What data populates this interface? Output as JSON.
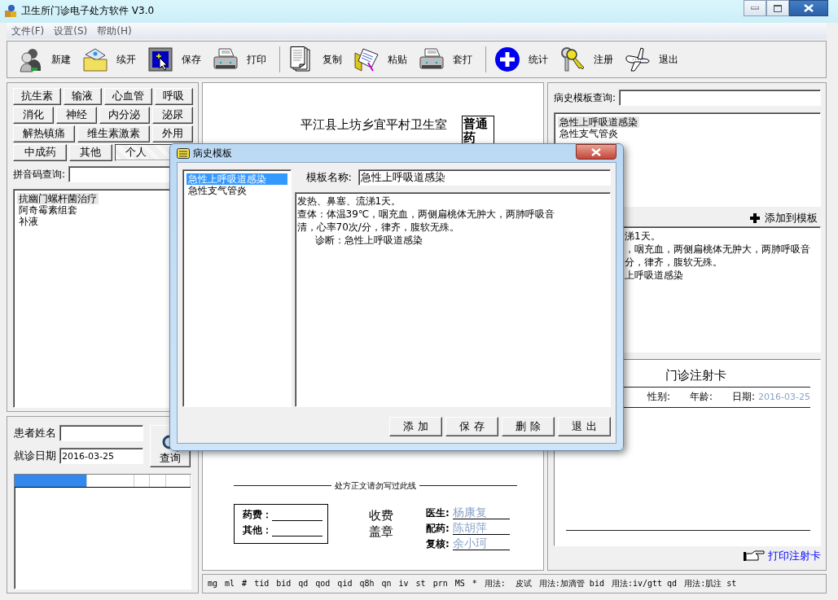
{
  "window": {
    "title": "卫生所门诊电子处方软件 V3.0"
  },
  "menu": [
    "文件(F)",
    "设置(S)",
    "帮助(H)"
  ],
  "toolbar": {
    "groups": [
      {
        "items": [
          {
            "label": "新建"
          },
          {
            "label": "续开"
          },
          {
            "label": "保存"
          },
          {
            "label": "打印"
          }
        ]
      },
      {
        "items": [
          {
            "label": "复制"
          },
          {
            "label": "粘贴"
          },
          {
            "label": "套打"
          }
        ]
      },
      {
        "items": [
          {
            "label": "统计"
          },
          {
            "label": "注册"
          },
          {
            "label": "退出"
          }
        ]
      }
    ]
  },
  "categories": [
    {
      "buttons": [
        {
          "label": "抗生素",
          "selected": false
        },
        {
          "label": "输液",
          "selected": false
        },
        {
          "label": "心血管",
          "selected": false
        },
        {
          "label": "呼吸",
          "selected": false
        }
      ]
    },
    {
      "buttons": [
        {
          "label": "消化",
          "selected": false
        },
        {
          "label": "神经",
          "selected": false
        },
        {
          "label": "内分泌",
          "selected": false
        },
        {
          "label": "泌尿",
          "selected": false
        }
      ]
    },
    {
      "buttons": [
        {
          "label": "解热镇痛",
          "selected": false
        },
        {
          "label": "维生素激素",
          "selected": false
        },
        {
          "label": "外用",
          "selected": false
        }
      ]
    },
    {
      "buttons": [
        {
          "label": "中成药",
          "selected": false
        },
        {
          "label": "其他",
          "selected": false
        },
        {
          "label": "个人",
          "selected": true
        }
      ]
    }
  ],
  "pinyin_search": {
    "label": "拼音码查询:"
  },
  "drug_groups": [
    {
      "label": "抗幽门螺杆菌治疗",
      "selected": true
    },
    {
      "label": "阿奇霉素组套",
      "selected": false
    },
    {
      "label": "补液",
      "selected": false
    }
  ],
  "patient": {
    "name_label": "患者姓名",
    "date_label": "就诊日期",
    "date_value": "2016-03-25",
    "query_button": "查询"
  },
  "prescription": {
    "clinic": "平江县上坊乡宜平村卫生室",
    "category_box": "普通药",
    "divider_note": "处方正文请勿写过此线",
    "fees": [
      {
        "label": "药费："
      },
      {
        "label": "其他："
      }
    ],
    "stamp": [
      "收费",
      "盖章"
    ],
    "signatures": [
      {
        "label": "医生:",
        "value": "杨康复"
      },
      {
        "label": "配药:",
        "value": "陈胡萍"
      },
      {
        "label": "复核:",
        "value": "余小珂"
      }
    ]
  },
  "usage_bar": [
    "mg",
    "ml",
    "#",
    "tid",
    "bid",
    "qd",
    "qod",
    "qid",
    "q8h",
    "qn",
    "iv",
    "st",
    "prn",
    "MS",
    "*",
    "用法:  皮试",
    "用法:加滴管 bid",
    "用法:iv/gtt qd",
    "用法:肌注 st"
  ],
  "history": {
    "search_label": "病史模板查询:",
    "templates": [
      {
        "label": "急性上呼吸道感染",
        "selected": true
      },
      {
        "label": "急性支气管炎",
        "selected": false
      }
    ],
    "add_button": "添加到模板",
    "record_lines": [
      "涕1天。",
      "，咽充血，两侧扁桃体无肿大，两肺呼吸音",
      "分，律齐，腹软无殊。",
      "上呼吸道感染"
    ]
  },
  "injection_card": {
    "title": "门诊注射卡",
    "fields": [
      {
        "label": "性别:"
      },
      {
        "label": "年龄:"
      },
      {
        "label": "日期:",
        "value": "2016-03-25"
      }
    ],
    "print_link": "打印注射卡"
  },
  "dialog": {
    "title": "病史模板",
    "templates": [
      {
        "label": "急性上呼吸道感染",
        "selected": true
      },
      {
        "label": "急性支气管炎",
        "selected": false
      }
    ],
    "name_label": "模板名称:",
    "name_value": "急性上呼吸道感染",
    "content": [
      "发热、鼻塞、流涕1天。",
      "查体：体温39℃，咽充血，两侧扁桃体无肿大，两肺呼吸音清，心率70次/分，律齐，腹软无殊。",
      "      诊断：急性上呼吸道感染"
    ],
    "buttons": [
      "添 加",
      "保 存",
      "删 除",
      "退 出"
    ]
  }
}
